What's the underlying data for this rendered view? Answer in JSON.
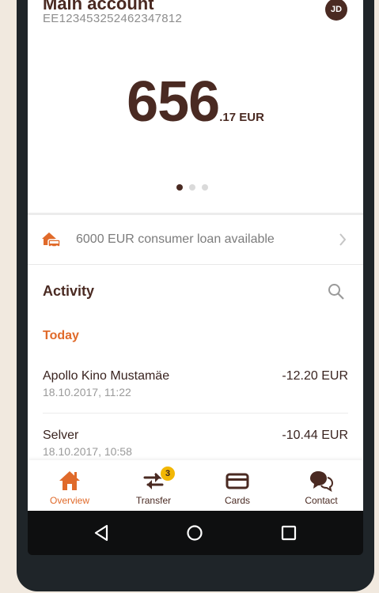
{
  "account": {
    "title": "Main account",
    "iban": "EE123453252462347812",
    "avatar_initials": "JD",
    "balance_main": "656",
    "balance_decimal": ".17 EUR",
    "carousel_pages": 3,
    "carousel_active": 1
  },
  "loan": {
    "text": "6000 EUR consumer loan available",
    "icon": "house-car-icon"
  },
  "activity": {
    "title": "Activity",
    "section_today": "Today",
    "transactions": [
      {
        "name": "Apollo Kino Mustamäe",
        "date": "18.10.2017, 11:22",
        "amount": "-12.20 EUR"
      },
      {
        "name": "Selver",
        "date": "18.10.2017, 10:58",
        "amount": "-10.44 EUR"
      }
    ]
  },
  "tabs": [
    {
      "label": "Overview",
      "icon": "home-icon",
      "active": true
    },
    {
      "label": "Transfer",
      "icon": "transfer-arrows-icon",
      "badge": "3"
    },
    {
      "label": "Cards",
      "icon": "card-icon"
    },
    {
      "label": "Contact",
      "icon": "chat-bubbles-icon"
    }
  ],
  "colors": {
    "brand_dark": "#4a2a22",
    "accent_orange": "#e06a2a",
    "badge_yellow": "#f2b705",
    "background": "#f1e9df"
  },
  "android_nav": [
    "back-icon",
    "home-circle-icon",
    "recents-icon"
  ]
}
